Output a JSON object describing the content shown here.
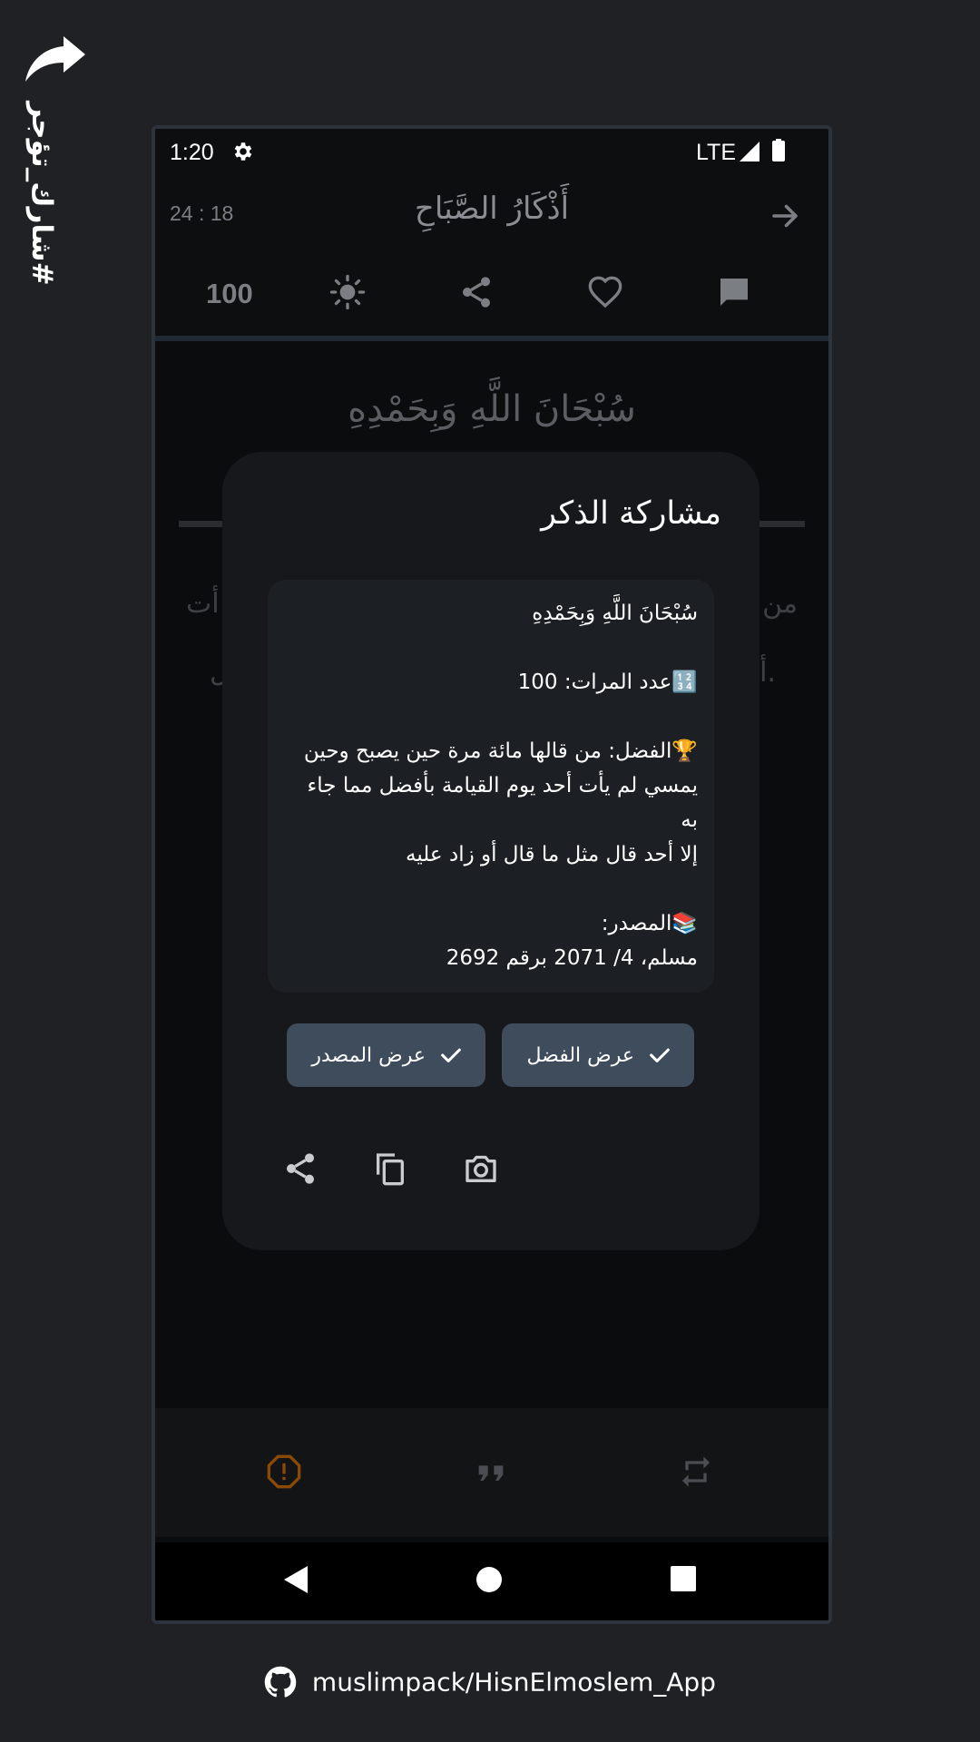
{
  "side": {
    "tag": "#شارك_تؤجر"
  },
  "status": {
    "time": "1:20",
    "network": "LTE"
  },
  "header": {
    "timer": "24 : 18",
    "title": "أَذْكَارُ الصَّبَاحِ"
  },
  "toolbar": {
    "count": "100"
  },
  "background": {
    "dhikr": "سُبْحَانَ اللَّهِ وَبِحَمْدِهِ",
    "peek_left_1": "أت",
    "peek_right_1": "من",
    "peek_left_2": "ل",
    "peek_right_2": "أ."
  },
  "dialog": {
    "title": "مشاركة الذكر",
    "dhikr": "سُبْحَانَ اللَّهِ وَبِحَمْدِهِ",
    "count_line": "🔢عدد المرات: 100",
    "virtue_lines": [
      "🏆الفضل: من قالها مائة مرة حين يصبح وحين",
      "يمسي لم يأت أحد يوم القيامة بأفضل مما جاء به",
      "إلا أحد قال مثل ما قال أو زاد عليه"
    ],
    "source_label": "📚المصدر:",
    "source_text": "مسلم، 4/ 2071 برقم 2692",
    "chip_virtue": "عرض الفضل",
    "chip_source": "عرض المصدر"
  },
  "footer": {
    "repo": "muslimpack/HisnElmoslem_App"
  },
  "colors": {
    "warning_icon": "#8a4a06",
    "chip_bg": "#3e4c5b",
    "dialog_bg": "#16181b"
  }
}
